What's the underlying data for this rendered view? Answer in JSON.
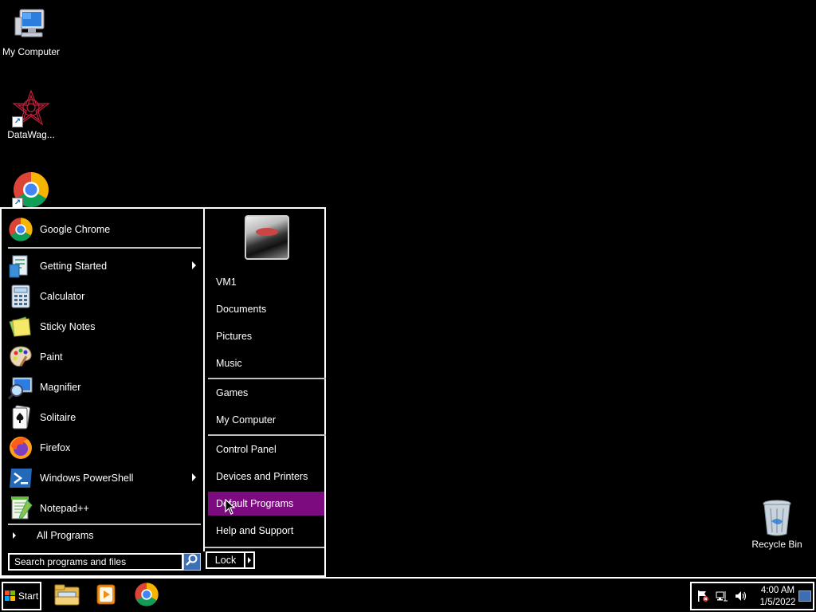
{
  "desktop": {
    "icons": [
      {
        "name": "my-computer",
        "label": "My Computer",
        "icon": "computer-icon"
      },
      {
        "name": "datawag",
        "label": "DataWag...",
        "icon": "datawag-icon"
      },
      {
        "name": "google-chrome-desktop",
        "label": "",
        "icon": "chrome-icon"
      },
      {
        "name": "recycle-bin",
        "label": "Recycle Bin",
        "icon": "recycle-bin-icon"
      }
    ]
  },
  "start_menu": {
    "pinned": [
      {
        "label": "Google Chrome",
        "icon": "chrome-icon",
        "submenu": false
      }
    ],
    "recent": [
      {
        "label": "Getting Started",
        "icon": "getting-started-icon",
        "submenu": true
      },
      {
        "label": "Calculator",
        "icon": "calculator-icon",
        "submenu": false
      },
      {
        "label": "Sticky Notes",
        "icon": "sticky-notes-icon",
        "submenu": false
      },
      {
        "label": "Paint",
        "icon": "paint-icon",
        "submenu": false
      },
      {
        "label": "Magnifier",
        "icon": "magnifier-icon",
        "submenu": false
      },
      {
        "label": "Solitaire",
        "icon": "solitaire-icon",
        "submenu": false
      },
      {
        "label": "Firefox",
        "icon": "firefox-icon",
        "submenu": false
      },
      {
        "label": "Windows PowerShell",
        "icon": "powershell-icon",
        "submenu": true
      },
      {
        "label": "Notepad++",
        "icon": "notepadpp-icon",
        "submenu": false
      }
    ],
    "all_programs_label": "All Programs",
    "search_placeholder": "Search programs and files",
    "right": {
      "user_items": [
        "VM1",
        "Documents",
        "Pictures",
        "Music"
      ],
      "system_items": [
        "Games",
        "My Computer"
      ],
      "settings_items": [
        "Control Panel",
        "Devices and Printers",
        "Default Programs",
        "Help and Support"
      ],
      "highlighted": "Default Programs"
    },
    "lock_label": "Lock"
  },
  "taskbar": {
    "start_label": "Start",
    "pinned": [
      "file-explorer-icon",
      "media-player-icon",
      "chrome-icon"
    ],
    "tray_icons": [
      "action-center-flag-icon",
      "network-icon",
      "volume-icon"
    ],
    "clock": {
      "time": "4:00 AM",
      "date": "1/5/2022"
    }
  },
  "colors": {
    "background": "#000000",
    "highlight": "#7d0b80",
    "border": "#ffffff"
  }
}
